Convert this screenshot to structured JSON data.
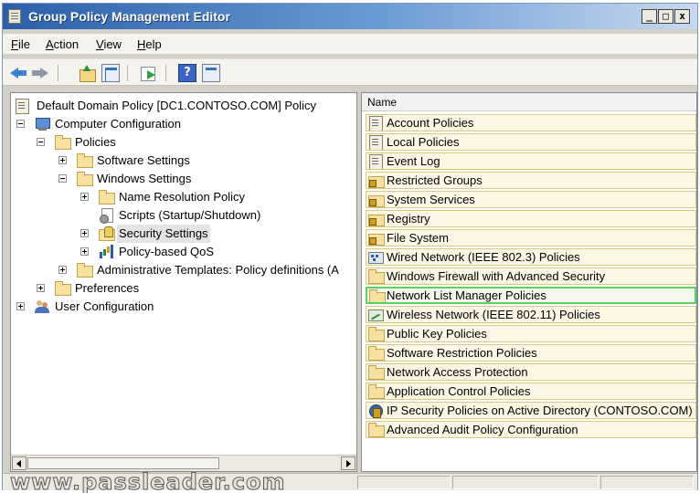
{
  "window": {
    "title": "Group Policy Management Editor",
    "controls": {
      "minimize": "_",
      "maximize": "□",
      "close": "x"
    }
  },
  "menu": {
    "items": [
      "File",
      "Action",
      "View",
      "Help"
    ]
  },
  "toolbar": {
    "buttons": [
      "back-icon",
      "forward-icon",
      "up-folder-icon",
      "show-hide-tree-icon",
      "export-list-icon",
      "help-icon",
      "properties-icon"
    ],
    "help_label": "?"
  },
  "tree": {
    "items": [
      {
        "label": "Default Domain Policy [DC1.CONTOSO.COM] Policy",
        "icon": "policy-icon",
        "expander": "none",
        "level": 0
      },
      {
        "label": "Computer Configuration",
        "icon": "computer-icon",
        "expander": "minus",
        "level": 0
      },
      {
        "label": "Policies",
        "icon": "folder-icon",
        "expander": "minus",
        "level": 1
      },
      {
        "label": "Software Settings",
        "icon": "folder-icon",
        "expander": "plus",
        "level": 2
      },
      {
        "label": "Windows Settings",
        "icon": "folder-icon",
        "expander": "minus",
        "level": 2
      },
      {
        "label": "Name Resolution Policy",
        "icon": "folder-icon",
        "expander": "plus",
        "level": 3
      },
      {
        "label": "Scripts (Startup/Shutdown)",
        "icon": "scripts-icon",
        "expander": "none",
        "level": 3
      },
      {
        "label": "Security Settings",
        "icon": "security-settings-icon",
        "expander": "plus",
        "level": 3,
        "selected": true
      },
      {
        "label": "Policy-based QoS",
        "icon": "qos-chart-icon",
        "expander": "plus",
        "level": 3
      },
      {
        "label": "Administrative Templates: Policy definitions (A",
        "icon": "folder-icon",
        "expander": "plus",
        "level": 2
      },
      {
        "label": "Preferences",
        "icon": "folder-icon",
        "expander": "plus",
        "level": 1
      },
      {
        "label": "User Configuration",
        "icon": "users-icon",
        "expander": "plus",
        "level": 0
      }
    ]
  },
  "list": {
    "column_header": "Name",
    "items": [
      {
        "label": "Account Policies",
        "icon": "policy-icon"
      },
      {
        "label": "Local Policies",
        "icon": "policy-icon"
      },
      {
        "label": "Event Log",
        "icon": "policy-icon"
      },
      {
        "label": "Restricted Groups",
        "icon": "locked-folder-icon"
      },
      {
        "label": "System Services",
        "icon": "locked-folder-icon"
      },
      {
        "label": "Registry",
        "icon": "locked-folder-icon"
      },
      {
        "label": "File System",
        "icon": "locked-folder-icon"
      },
      {
        "label": "Wired Network (IEEE 802.3) Policies",
        "icon": "wired-network-icon"
      },
      {
        "label": "Windows Firewall with Advanced Security",
        "icon": "folder-icon"
      },
      {
        "label": "Network List Manager Policies",
        "icon": "folder-icon",
        "highlighted": true
      },
      {
        "label": "Wireless Network (IEEE 802.11) Policies",
        "icon": "wireless-network-icon"
      },
      {
        "label": "Public Key Policies",
        "icon": "folder-icon"
      },
      {
        "label": "Software Restriction Policies",
        "icon": "folder-icon"
      },
      {
        "label": "Network Access Protection",
        "icon": "folder-icon"
      },
      {
        "label": "Application Control Policies",
        "icon": "folder-icon"
      },
      {
        "label": "IP Security Policies on Active Directory (CONTOSO.COM)",
        "icon": "ipsec-icon"
      },
      {
        "label": "Advanced Audit Policy Configuration",
        "icon": "folder-icon"
      }
    ]
  },
  "watermark": "www.passleader.com",
  "colors": {
    "highlight_border": "#5fd05f",
    "title_gradient_start": "#2b5fa8"
  }
}
